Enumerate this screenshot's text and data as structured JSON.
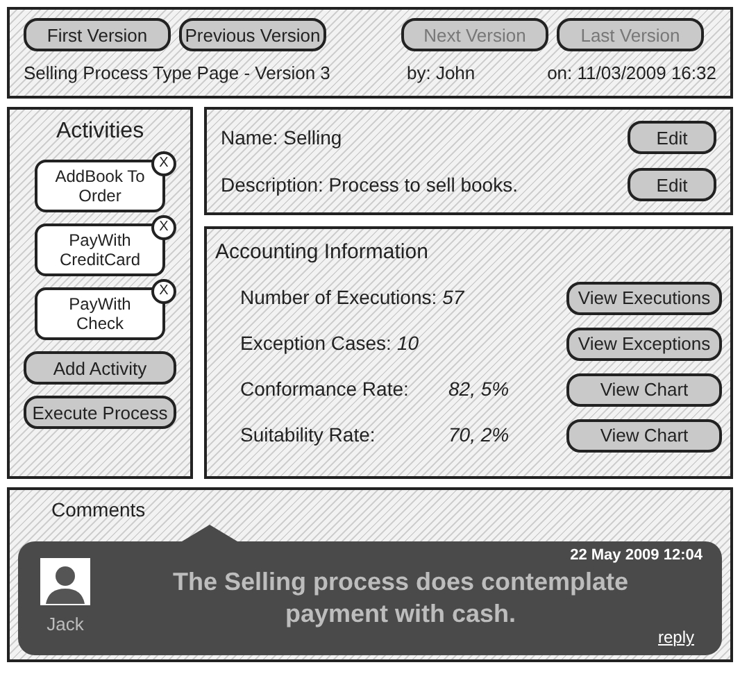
{
  "version_bar": {
    "buttons": [
      {
        "label": "First Version",
        "disabled": false
      },
      {
        "label": "Previous Version",
        "disabled": false
      },
      {
        "label": "Next Version",
        "disabled": true
      },
      {
        "label": "Last Version",
        "disabled": true
      }
    ],
    "page_title": "Selling Process Type Page - Version 3",
    "author": "by: John",
    "date": "on: 11/03/2009 16:32"
  },
  "activities": {
    "title": "Activities",
    "items": [
      {
        "label": "AddBook To Order",
        "remove": "X"
      },
      {
        "label": "PayWith CreditCard",
        "remove": "X"
      },
      {
        "label": "PayWith Check",
        "remove": "X"
      }
    ],
    "buttons": [
      "Add Activity",
      "Execute Process"
    ]
  },
  "details": {
    "fields": [
      {
        "text": "Name: Selling",
        "button": "Edit"
      },
      {
        "text": "Description: Process to sell books.",
        "button": "Edit"
      }
    ]
  },
  "accounting": {
    "title": "Accounting Information",
    "rows": [
      {
        "kind": "count",
        "label": "Number of Executions:",
        "value": "57",
        "button": "View Executions"
      },
      {
        "kind": "count",
        "label": "Exception Cases:",
        "value": "10",
        "button": "View Exceptions"
      },
      {
        "kind": "rate",
        "label": "Conformance Rate:",
        "value": "82, 5%",
        "button": "View Chart"
      },
      {
        "kind": "rate",
        "label": "Suitability Rate:",
        "value": "70, 2%",
        "button": "View Chart"
      }
    ]
  },
  "comments": {
    "title": "Comments",
    "items": [
      {
        "author": "Jack",
        "date": "22 May 2009 12:04",
        "text": "The Selling process does contemplate payment with cash.",
        "reply": "reply"
      }
    ]
  }
}
